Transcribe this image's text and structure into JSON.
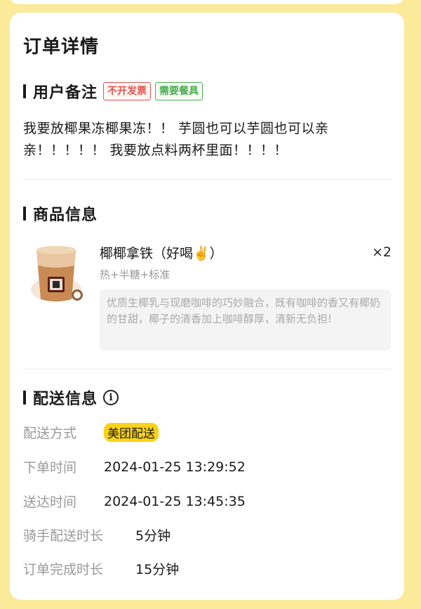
{
  "order": {
    "title": "订单详情",
    "user_note": {
      "heading": "用户备注",
      "tags": [
        "不开发票",
        "需要餐具"
      ],
      "text": "我要放椰果冻椰果冻！！ 芋圆也可以芋圆也可以亲亲！！！！！ 我要放点料两杯里面！！！！"
    },
    "product": {
      "heading": "商品信息",
      "name": "椰椰拿铁（好喝✌️）",
      "quantity": "×2",
      "spec": "热+半糖+标准",
      "description": "优质生椰乳与现磨咖啡的巧妙融合，既有咖啡的香又有椰奶的甘甜，椰子的清香加上咖啡醇厚，清新无负担!",
      "image_icon": "coconut-latte-cup-image"
    },
    "delivery": {
      "heading": "配送信息",
      "info_icon": "info-icon",
      "rows": [
        {
          "label": "配送方式",
          "value": "美团配送"
        },
        {
          "label": "下单时间",
          "value": "2024-01-25 13:29:52"
        },
        {
          "label": "送达时间",
          "value": "2024-01-25 13:45:35"
        },
        {
          "label": "骑手配送时长",
          "value": "5分钟"
        },
        {
          "label": "订单完成时长",
          "value": "15分钟"
        }
      ]
    }
  },
  "colors": {
    "page_bg": "#FBEA9A",
    "card_bg": "#FFFFFF",
    "tag_red": "#E5534B",
    "tag_green": "#4CAF50",
    "badge_yellow": "#F9D31A",
    "label_gray": "#999999"
  }
}
